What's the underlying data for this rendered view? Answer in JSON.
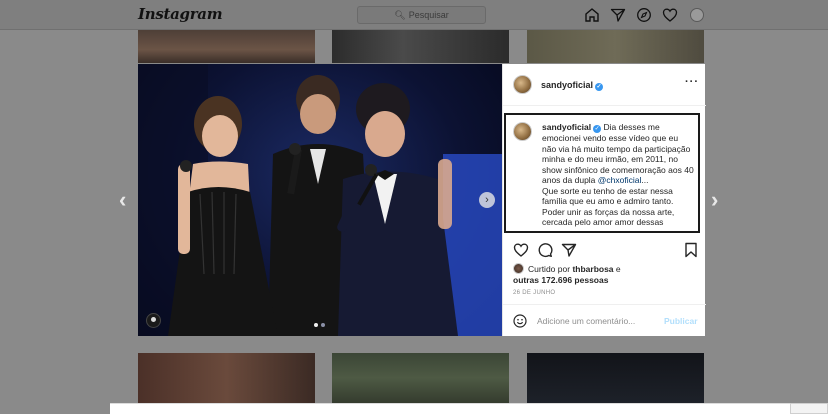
{
  "nav": {
    "logo": "Instagram",
    "search_placeholder": "Pesquisar",
    "icons": [
      "home-icon",
      "direct-icon",
      "explore-icon",
      "activity-heart-icon",
      "profile-avatar"
    ]
  },
  "post": {
    "username": "sandyoficial",
    "verified": true,
    "caption": {
      "username": "sandyoficial",
      "text_1": "Dia desses me emocionei vendo esse vídeo que eu não via há muito tempo da participação minha e do meu irmão, em 2011, no show sinfônico de comemoração aos 40 anos da dupla",
      "mention": "@chxoficial",
      "ellipsis": "...",
      "text_2": "Que sorte eu tenho de estar nessa família que eu amo e admiro tanto. Poder unir as forças da nossa arte, cercada pelo amor amor dessas"
    },
    "likes": {
      "prefix": "Curtido por",
      "user": "thbarbosa",
      "connector": "e",
      "others": "outras 172.696 pessoas"
    },
    "date": "26 DE JUNHO",
    "comment_placeholder": "Adicione um comentário...",
    "publish_label": "Publicar",
    "carousel_dots": 2,
    "carousel_active": 1
  },
  "colors": {
    "overlay": "#8a8a8a",
    "verified": "#3897f0",
    "mention": "#00376b",
    "publish_disabled": "#b2dffc"
  }
}
